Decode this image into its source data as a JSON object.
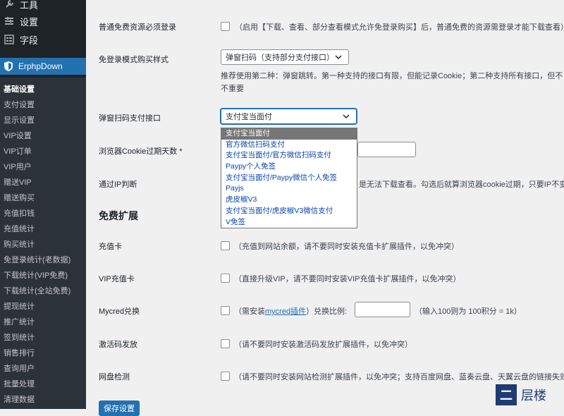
{
  "sidebar": {
    "top_items": [
      {
        "label": "工具",
        "icon": "wrench-icon"
      },
      {
        "label": "设置",
        "icon": "settings-icon"
      },
      {
        "label": "字段",
        "icon": "fields-icon"
      }
    ],
    "active_plugin": {
      "label": "ErphpDown",
      "icon": "shield-icon"
    },
    "submenu": [
      "基础设置",
      "支付设置",
      "显示设置",
      "VIP设置",
      "VIP订单",
      "VIP用户",
      "赠送VIP",
      "赠送购买",
      "充值扣钱",
      "充值统计",
      "购买统计",
      "免登录统计(老数据)",
      "下载统计(VIP免费)",
      "下载统计(全站免费)",
      "提现统计",
      "推广统计",
      "签到统计",
      "销售排行",
      "查询用户",
      "批量处理",
      "清理数据"
    ]
  },
  "settings": {
    "login_required": {
      "label": "普通免费资源必须登录",
      "desc": "（启用【下载、查看、部分查看模式允许免登录购买】后，普通免费的资源需登录才能下载查看）"
    },
    "guest_buy_style": {
      "label": "免登录模式购买样式",
      "value": "弹窗扫码（支持部分支付接口）",
      "desc1": "推荐使用第二种：弹窗跳转。第一种支持的接口有限，但能记录Cookie；第二种支持所有接口，但不",
      "desc2": "不重要"
    },
    "popup_pay_gateway": {
      "label": "弹窗扫码支付接口",
      "value": "支付宝当面付",
      "options": [
        "支付宝当面付",
        "官方微信扫码支付",
        "支付宝当面付/官方微信扫码支付",
        "Paypy个人免签",
        "支付宝当面付/Paypy微信个人免签",
        "Payjs",
        "虎皮椒V3",
        "支付宝当面付/虎皮椒V3微信支付",
        "V免签"
      ]
    },
    "cookie_days": {
      "label": "浏览器Cookie过期天数 *"
    },
    "ip_check": {
      "label": "通过IP判断",
      "desc": "是无法下载查看。勾选后就算浏览器cookie过期，只要IP不变"
    }
  },
  "free_extensions": {
    "heading": "免费扩展",
    "recharge_card": {
      "label": "充值卡",
      "desc": "（充值到网站余额，请不要同时安装充值卡扩展插件，以免冲突）"
    },
    "vip_card": {
      "label": "VIP充值卡",
      "desc": "（直接升级VIP，请不要同时安装VIP充值卡扩展插件，以免冲突）"
    },
    "mycred": {
      "label": "Mycred兑换",
      "desc_pre": "（需安装",
      "link": "mycred插件",
      "desc_post": "）兑换比例:",
      "ratio_hint": "（输入100则为 100积分 = 1k）"
    },
    "activation_code": {
      "label": "激活码发放",
      "desc": "（请不要同时安装激活码发放扩展插件，以免冲突）"
    },
    "netdisk_check": {
      "label": "网盘检测",
      "desc": "（请不要同时安装网站检测扩展插件，以免冲突；支持百度网盘、蓝奏云盘、天翼云盘的链接失效"
    }
  },
  "save_button": "保存设置",
  "watermark": {
    "box": "二",
    "text": "层楼"
  },
  "colors": {
    "sidebar_bg": "#1d2327",
    "submenu_bg": "#2c3338",
    "accent": "#2271b1",
    "option_selected": "#767676"
  }
}
